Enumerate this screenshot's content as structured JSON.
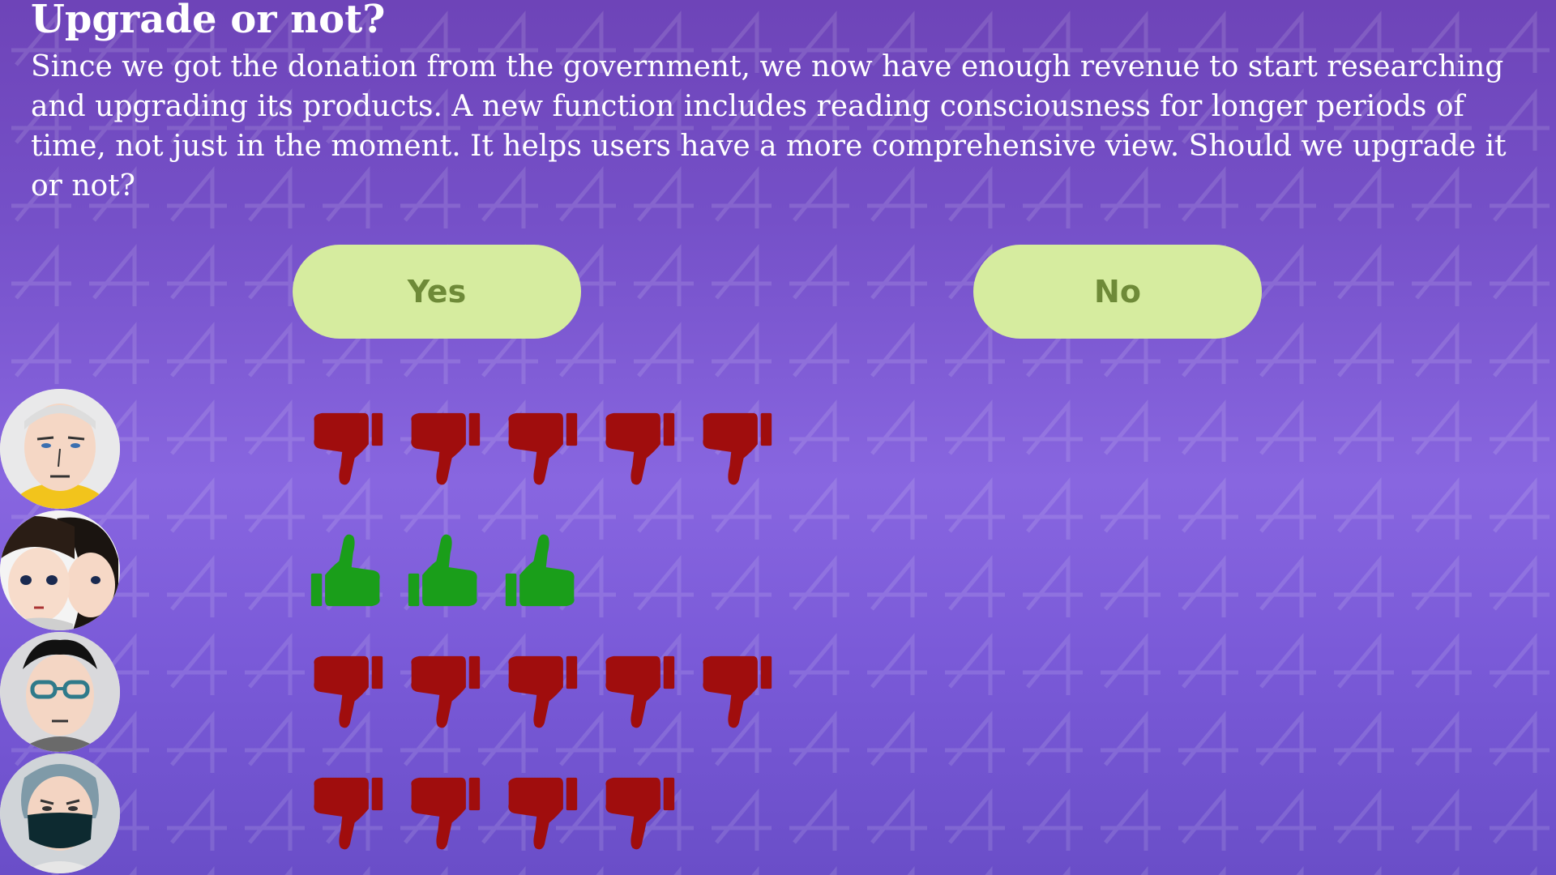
{
  "title": "Upgrade or not?",
  "description": "Since we got the donation from the government, we now have enough revenue to start researching and upgrading its products. A new function includes reading consciousness for longer periods of time, not just in the moment. It helps users have a more comprehensive view. Should we upgrade it or not?",
  "choices": {
    "yes_label": "Yes",
    "no_label": "No"
  },
  "colors": {
    "background_top": "#6e44b8",
    "background_mid": "#8866e0",
    "button_fill": "#d6ec9f",
    "button_text": "#6e8a38",
    "thumbs_down": "#a00d0d",
    "thumbs_up": "#1a9e1a"
  },
  "voters": [
    {
      "avatar_icon": "bald-man-avatar-icon",
      "vote_icon": "thumbs-down-icon",
      "count": 5
    },
    {
      "avatar_icon": "twins-avatar-icon",
      "vote_icon": "thumbs-up-icon",
      "count": 3
    },
    {
      "avatar_icon": "glasses-man-avatar-icon",
      "vote_icon": "thumbs-down-icon",
      "count": 5
    },
    {
      "avatar_icon": "masked-woman-avatar-icon",
      "vote_icon": "thumbs-down-icon",
      "count": 4
    }
  ]
}
